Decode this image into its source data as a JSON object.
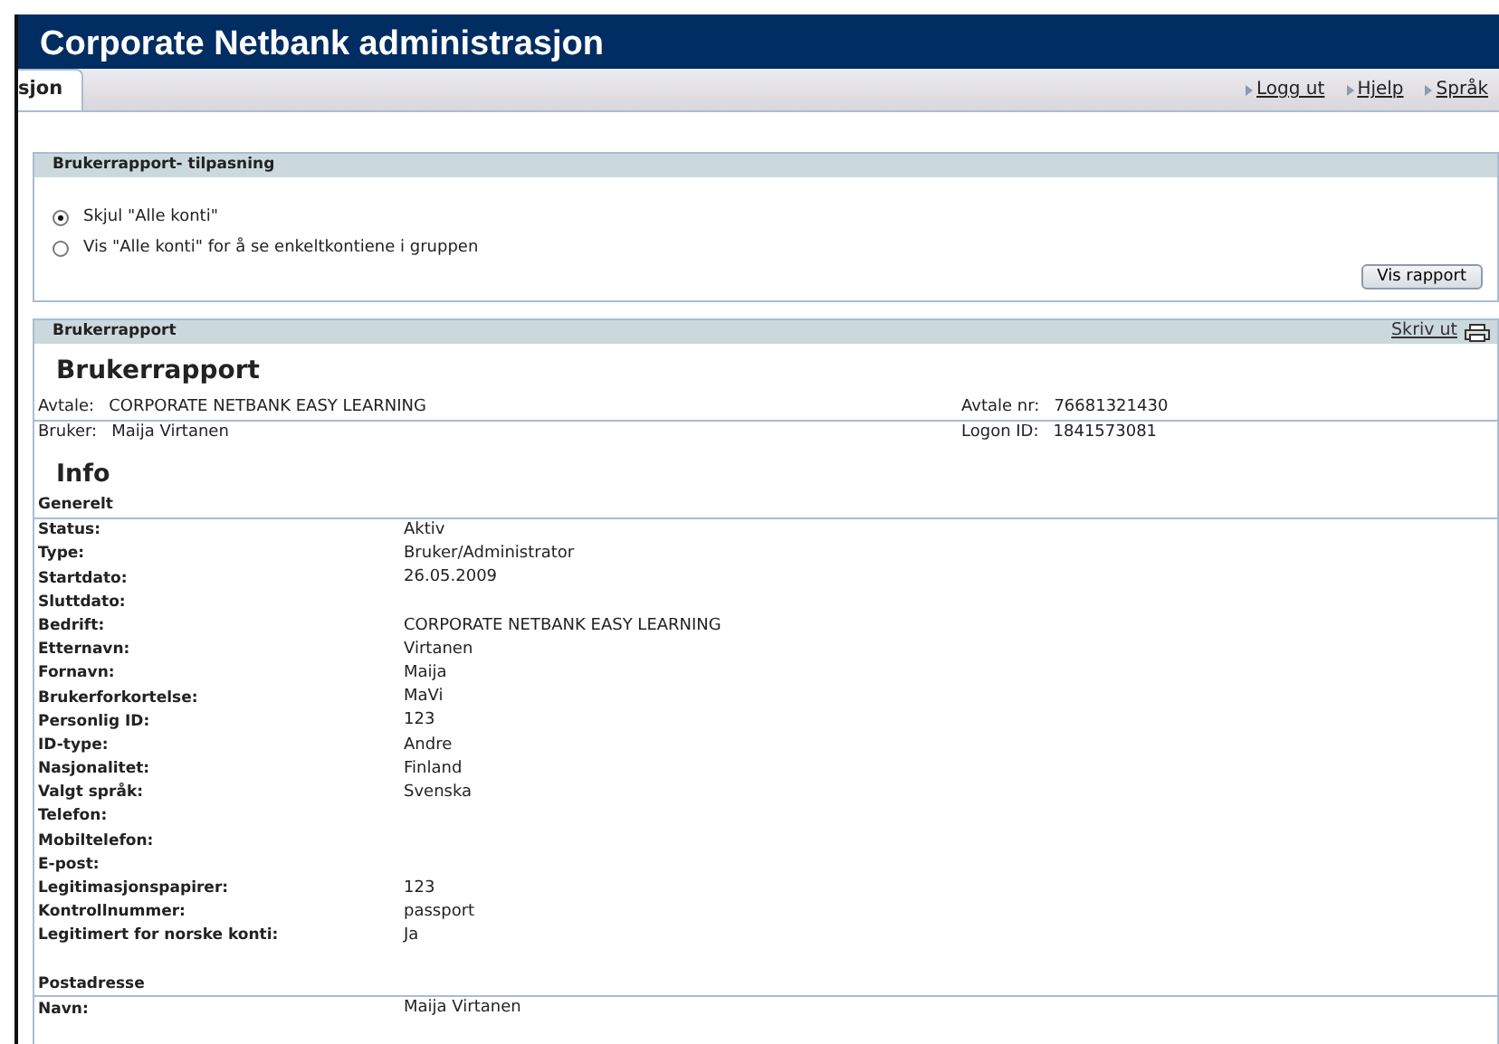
{
  "window": {
    "title": "Corporate Netbank administrasjon"
  },
  "tabs": [
    {
      "label": "sjon",
      "selected": true
    }
  ],
  "top_links": [
    "Logg ut",
    "Hjelp",
    "Språk"
  ],
  "customize_panel": {
    "title": "Brukerrapport- tilpasning",
    "options": [
      {
        "label": "Skjul \"Alle konti\"",
        "selected": true
      },
      {
        "label": "Vis \"Alle konti\" for å se enkeltkontiene i gruppen",
        "selected": false
      }
    ],
    "button": "Vis rapport"
  },
  "report_panel": {
    "title": "Brukerrapport",
    "print_link": "Skriv ut",
    "heading": "Brukerrapport",
    "header_rows": [
      {
        "left_label": "Avtale:",
        "left_value": "CORPORATE NETBANK EASY LEARNING",
        "right_label": "Avtale nr:",
        "right_value": "76681321430"
      },
      {
        "left_label": "Bruker:",
        "left_value": "Maija Virtanen",
        "right_label": "Logon ID:",
        "right_value": "1841573081"
      }
    ],
    "section_title": "Info",
    "groups": [
      {
        "title": "Generelt",
        "rows": [
          {
            "label": "Status:",
            "value": "Aktiv"
          },
          {
            "label": "Type:",
            "value": "Bruker/Administrator"
          },
          {
            "label": "Startdato:",
            "value": "26.05.2009"
          },
          {
            "label": "Sluttdato:"
          },
          {
            "label": "Bedrift:",
            "value": "CORPORATE NETBANK EASY LEARNING"
          },
          {
            "label": "Etternavn:",
            "value": "Virtanen"
          },
          {
            "label": "Fornavn:",
            "value": "Maija"
          },
          {
            "label": "Brukerforkortelse:",
            "value": "MaVi"
          },
          {
            "label": "Personlig ID:",
            "value": "123"
          },
          {
            "label": "ID-type:",
            "value": "Andre"
          },
          {
            "label": "Nasjonalitet:",
            "value": "Finland"
          },
          {
            "label": "Valgt språk:",
            "value": "Svenska"
          },
          {
            "label": "Telefon:"
          },
          {
            "label": "Mobiltelefon:"
          },
          {
            "label": "E-post:"
          },
          {
            "label": "Legitimasjonspapirer:",
            "value": "123"
          },
          {
            "label": "Kontrollnummer:",
            "value": "passport"
          },
          {
            "label": "Legitimert for norske konti:",
            "value": "Ja"
          }
        ]
      },
      {
        "title": "Postadresse",
        "rows": [
          {
            "label": "Navn:",
            "value": "Maija Virtanen"
          }
        ]
      }
    ]
  }
}
